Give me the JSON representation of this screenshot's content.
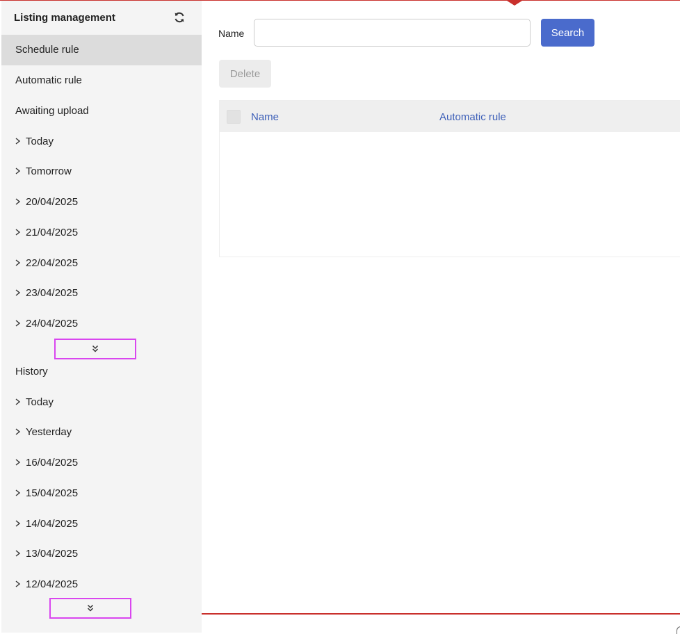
{
  "sidebar": {
    "title": "Listing management",
    "items": [
      {
        "label": "Schedule rule"
      },
      {
        "label": "Automatic rule"
      },
      {
        "label": "Awaiting upload"
      },
      {
        "label": "Today"
      },
      {
        "label": "Tomorrow"
      },
      {
        "label": "20/04/2025"
      },
      {
        "label": "21/04/2025"
      },
      {
        "label": "22/04/2025"
      },
      {
        "label": "23/04/2025"
      },
      {
        "label": "24/04/2025"
      },
      {
        "label": "History"
      },
      {
        "label": "Today"
      },
      {
        "label": "Yesterday"
      },
      {
        "label": "16/04/2025"
      },
      {
        "label": "15/04/2025"
      },
      {
        "label": "14/04/2025"
      },
      {
        "label": "13/04/2025"
      },
      {
        "label": "12/04/2025"
      }
    ]
  },
  "search": {
    "label": "Name",
    "value": "",
    "placeholder": "",
    "button": "Search"
  },
  "actions": {
    "delete": "Delete"
  },
  "table": {
    "columns": [
      "Name",
      "Automatic rule"
    ]
  },
  "colors": {
    "accent": "#4a6bcc",
    "brand_red": "#c9302c",
    "highlight": "#d946ef",
    "header_link": "#3d5fb8"
  }
}
